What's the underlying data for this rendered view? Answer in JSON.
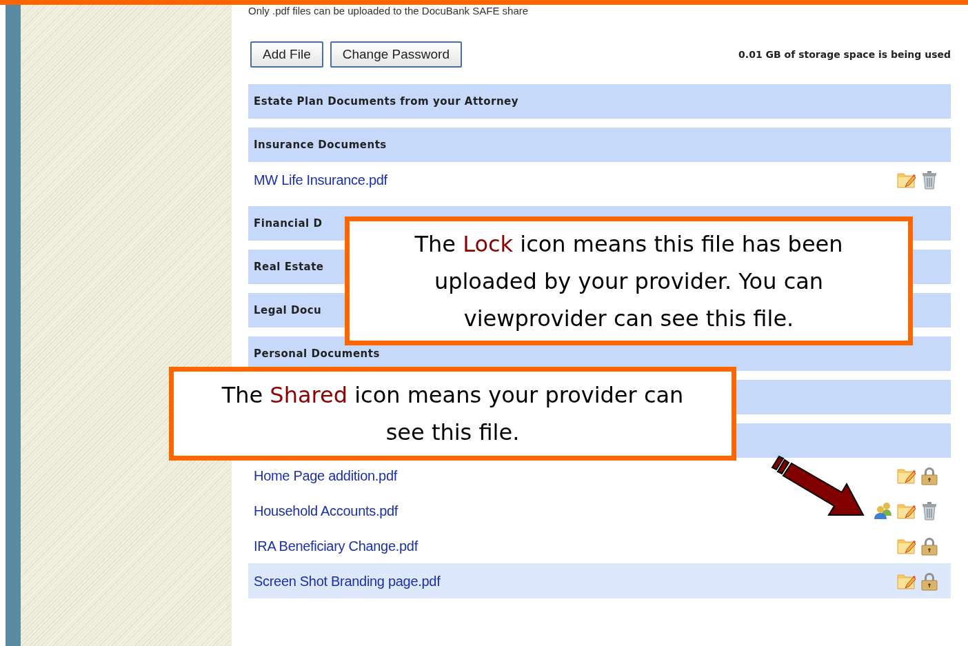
{
  "notice": "Only .pdf files can be uploaded to the DocuBank SAFE share",
  "buttons": [
    "Add File",
    "Change Password"
  ],
  "storage": "0.01 GB of storage space is being used",
  "sections": [
    {
      "kind": "header",
      "title": "Estate Plan Documents from your Attorney"
    },
    {
      "kind": "header",
      "title": "Insurance Documents",
      "files": [
        {
          "name": "MW Life Insurance.pdf",
          "shared": false,
          "locked": false,
          "highlighted": false
        }
      ]
    },
    {
      "kind": "header",
      "title": "Financial D"
    },
    {
      "kind": "header",
      "title": "Real Estate"
    },
    {
      "kind": "header",
      "title": "Legal Docu"
    },
    {
      "kind": "header",
      "title": "Personal Documents"
    },
    {
      "kind": "header"
    },
    {
      "kind": "header",
      "files": [
        {
          "name": "Home Page addition.pdf",
          "shared": false,
          "locked": true,
          "highlighted": false
        },
        {
          "name": "Household Accounts.pdf",
          "shared": true,
          "locked": false,
          "highlighted": false
        },
        {
          "name": "IRA Beneficiary Change.pdf",
          "shared": false,
          "locked": true,
          "highlighted": false
        },
        {
          "name": "Screen Shot Branding page.pdf",
          "shared": false,
          "locked": true,
          "highlighted": true
        }
      ]
    }
  ],
  "callouts": [
    {
      "kind": "lock",
      "text": "The **Lock** icon means this file has been uploaded by your provider. You can viewprovider can see this file."
    },
    {
      "kind": "shared",
      "text": "The **Shared** icon means your provider can see this file."
    }
  ]
}
